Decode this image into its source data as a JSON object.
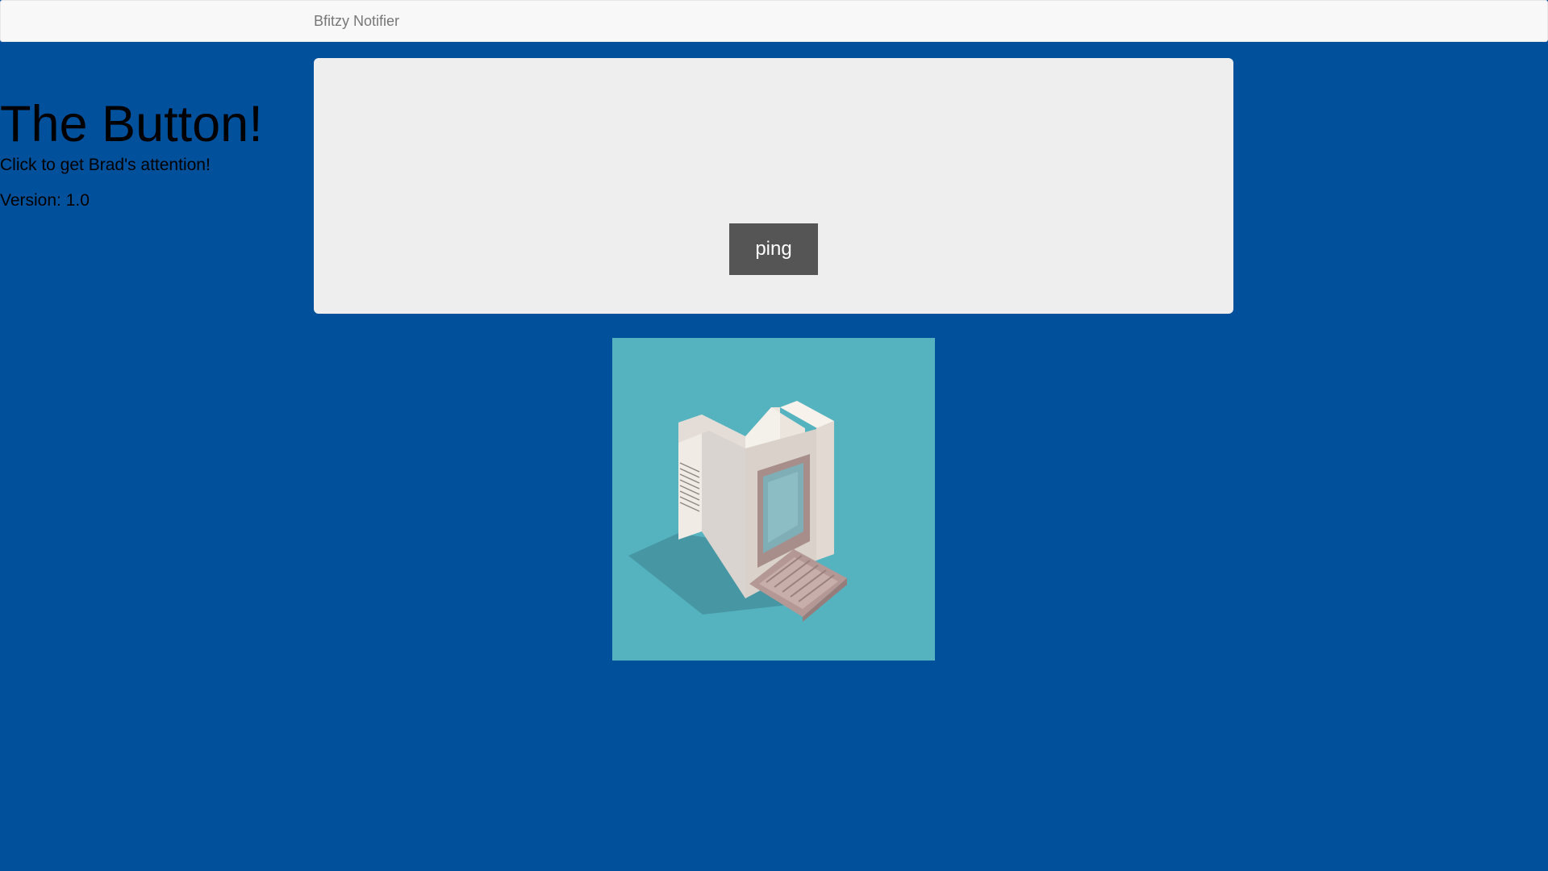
{
  "navbar": {
    "brand": "Bfitzy Notifier"
  },
  "jumbotron": {
    "title": "The Button!",
    "subtitle": "Click to get Brad's attention!",
    "version": "Version: 1.0",
    "button_label": "ping"
  },
  "illustration": {
    "name": "retro-computer-illustration",
    "background_color": "#55b3bf"
  },
  "colors": {
    "page_background": "#01509b",
    "navbar_background": "#f8f8f8",
    "panel_background": "#eeeeee",
    "button_background": "#555555",
    "button_text": "#ffffff"
  }
}
